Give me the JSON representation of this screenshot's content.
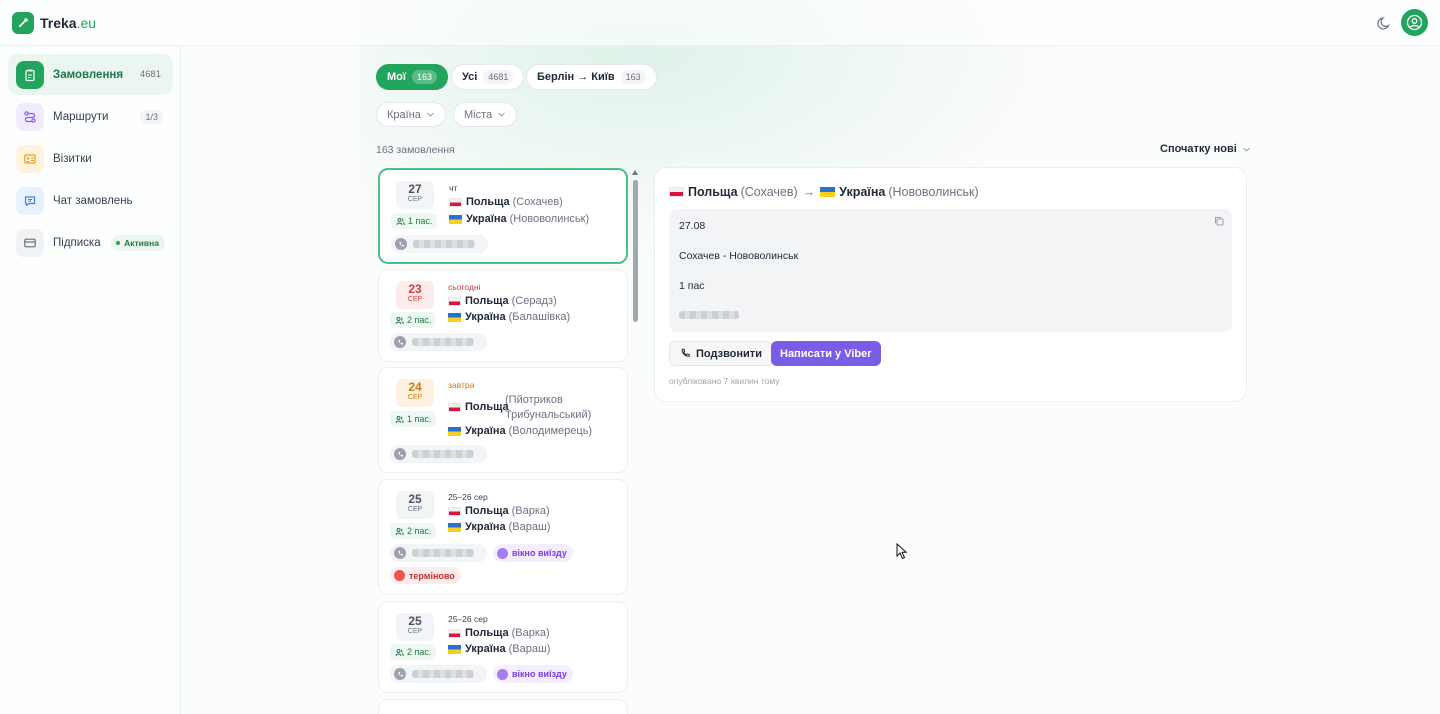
{
  "app": {
    "logo_name": "Treka",
    "logo_tld": ".eu"
  },
  "header": {
    "theme_icon": "moon-icon",
    "account_icon": "user-circle-icon"
  },
  "sidebar": {
    "items": [
      {
        "label": "Замовлення",
        "count": "4681",
        "icon": "clipboard-icon",
        "color": "#22a45d",
        "active": true
      },
      {
        "label": "Маршрути",
        "count": "1/3",
        "icon": "route-icon",
        "color": "#8b5cf6",
        "active": false
      },
      {
        "label": "Візитки",
        "count": "",
        "icon": "id-card-icon",
        "color": "#f59e0b",
        "active": false
      },
      {
        "label": "Чат замовлень",
        "count": "",
        "icon": "chat-icon",
        "color": "#3b82f6",
        "active": false
      },
      {
        "label": "Підписка",
        "badge": "Активна",
        "icon": "credit-card-icon",
        "color": "#6b7280",
        "active": false
      }
    ]
  },
  "tabs": [
    {
      "label": "Мої",
      "count": "163",
      "active": true
    },
    {
      "label": "Усі",
      "count": "4681",
      "active": false
    },
    {
      "label": "Берлін → Київ",
      "count": "163",
      "active": false
    }
  ],
  "filters": [
    {
      "label": "Країна"
    },
    {
      "label": "Міста"
    }
  ],
  "list": {
    "orders_count": "163 замовлення",
    "sort_label": "Спочатку нові"
  },
  "orders": [
    {
      "day": "27",
      "month": "СЕР",
      "tag": "чт",
      "from_country": "Польща",
      "from_city": "(Сохачев)",
      "to_country": "Україна",
      "to_city": "(Нововолинськ)",
      "pax": "1 пас."
    },
    {
      "day": "23",
      "month": "СЕР",
      "tag": "сьогодні",
      "from_country": "Польща",
      "from_city": "(Серадз)",
      "to_country": "Україна",
      "to_city": "(Балашівка)",
      "pax": "2 пас."
    },
    {
      "day": "24",
      "month": "СЕР",
      "tag": "завтра",
      "from_country": "Польща",
      "from_city_l1": "(Пйотриков",
      "from_city_l2": "Трибунальський)",
      "to_country": "Україна",
      "to_city": "(Володимерець)",
      "pax": "1 пас."
    },
    {
      "day": "25",
      "month": "СЕР",
      "tag": "25–26 сер",
      "from_country": "Польща",
      "from_city": "(Варка)",
      "to_country": "Україна",
      "to_city": "(Вараш)",
      "pax": "2 пас.",
      "window": "вікно виїзду",
      "urgent": "терміново"
    },
    {
      "day": "25",
      "month": "СЕР",
      "tag": "25–26 сер",
      "from_country": "Польща",
      "from_city": "(Варка)",
      "to_country": "Україна",
      "to_city": "(Вараш)",
      "pax": "2 пас.",
      "window": "вікно виїзду"
    }
  ],
  "detail": {
    "from_country": "Польща",
    "from_city": "(Сохачев)",
    "arrow": "→",
    "to_country": "Україна",
    "to_city": "(Нововолинськ)",
    "message_lines": [
      "27.08",
      "Сохачев - Нововолинськ",
      "1 пас"
    ],
    "call_label": "Подзвонити",
    "viber_label": "Написати у Viber",
    "published": "опубліковано 7 хвилин тому"
  },
  "colors": {
    "accent": "#22a45d",
    "viber": "#7b5ce6",
    "today": "#d33a3a",
    "tomorrow": "#cf7a12"
  }
}
